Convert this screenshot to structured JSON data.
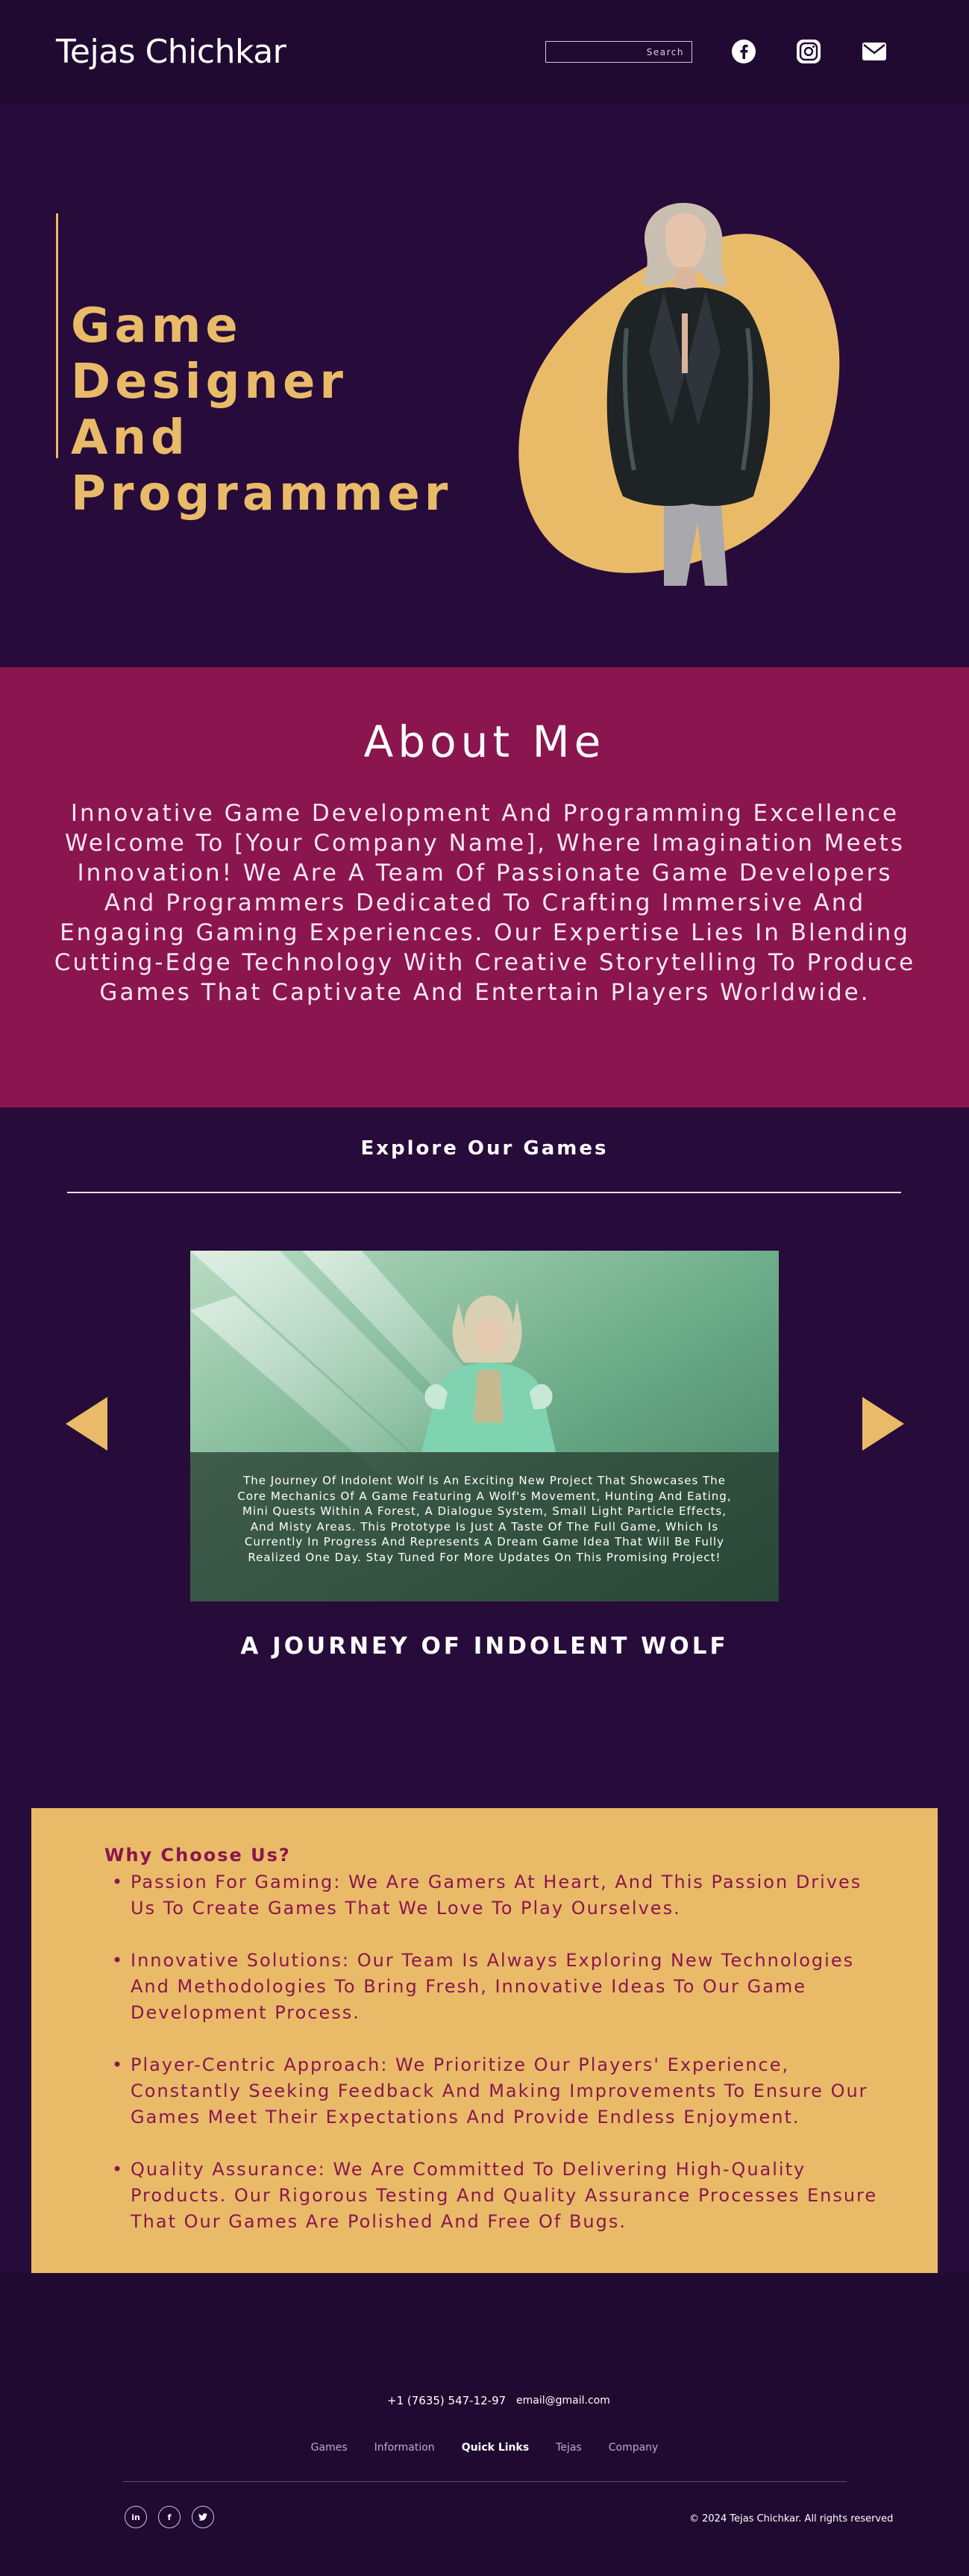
{
  "header": {
    "logo": "Tejas Chichkar",
    "search_placeholder": "Search",
    "icons": [
      "facebook-icon",
      "instagram-icon",
      "mail-icon"
    ]
  },
  "hero": {
    "title_lines": [
      "Game Designer",
      "And",
      "Programmer"
    ]
  },
  "about": {
    "title": "About Me",
    "text": "Innovative Game Development And Programming Excellence Welcome To [Your Company Name], Where Imagination Meets Innovation! We Are A Team Of Passionate Game Developers And Programmers Dedicated To Crafting Immersive And Engaging Gaming Experiences. Our Expertise Lies In Blending Cutting-Edge Technology With Creative Storytelling To Produce Games That Captivate And Entertain Players Worldwide."
  },
  "games": {
    "heading": "Explore Our Games",
    "caption": "The Journey Of Indolent Wolf Is An Exciting New Project That Showcases The Core Mechanics Of A Game Featuring A Wolf's Movement, Hunting And Eating, Mini Quests Within A Forest, A Dialogue System, Small Light Particle Effects, And Misty Areas. This Prototype Is Just A Taste Of The Full Game, Which Is Currently In Progress And Represents A Dream Game Idea That Will Be Fully Realized One Day. Stay Tuned For More Updates On This Promising Project!",
    "title": "A JOURNEY OF INDOLENT WOLF"
  },
  "why": {
    "title": "Why Choose Us?",
    "items": [
      "Passion For Gaming: We Are Gamers At Heart, And This Passion Drives Us To Create Games That We Love To Play Ourselves.",
      "Innovative Solutions: Our Team Is Always Exploring New Technologies And Methodologies To Bring Fresh, Innovative Ideas To Our Game Development Process.",
      "Player-Centric Approach: We Prioritize Our Players' Experience, Constantly Seeking Feedback And Making Improvements To Ensure Our Games Meet Their Expectations And Provide Endless Enjoyment.",
      "Quality Assurance: We Are Committed To Delivering High-Quality Products. Our Rigorous Testing And Quality Assurance Processes Ensure That Our Games Are Polished And Free Of Bugs."
    ]
  },
  "footer": {
    "phone": "+1 (7635) 547-12-97",
    "email": "email@gmail.com",
    "links": [
      "Games",
      "Information",
      "Quick Links",
      "Tejas",
      "Company"
    ],
    "social": [
      "in",
      "f",
      "t"
    ],
    "copyright": "© 2024 Tejas Chichkar. All rights reserved"
  },
  "colors": {
    "background": "#270b3a",
    "header": "#210a31",
    "accent_gold": "#e9bb69",
    "magenta": "#8b154e"
  }
}
